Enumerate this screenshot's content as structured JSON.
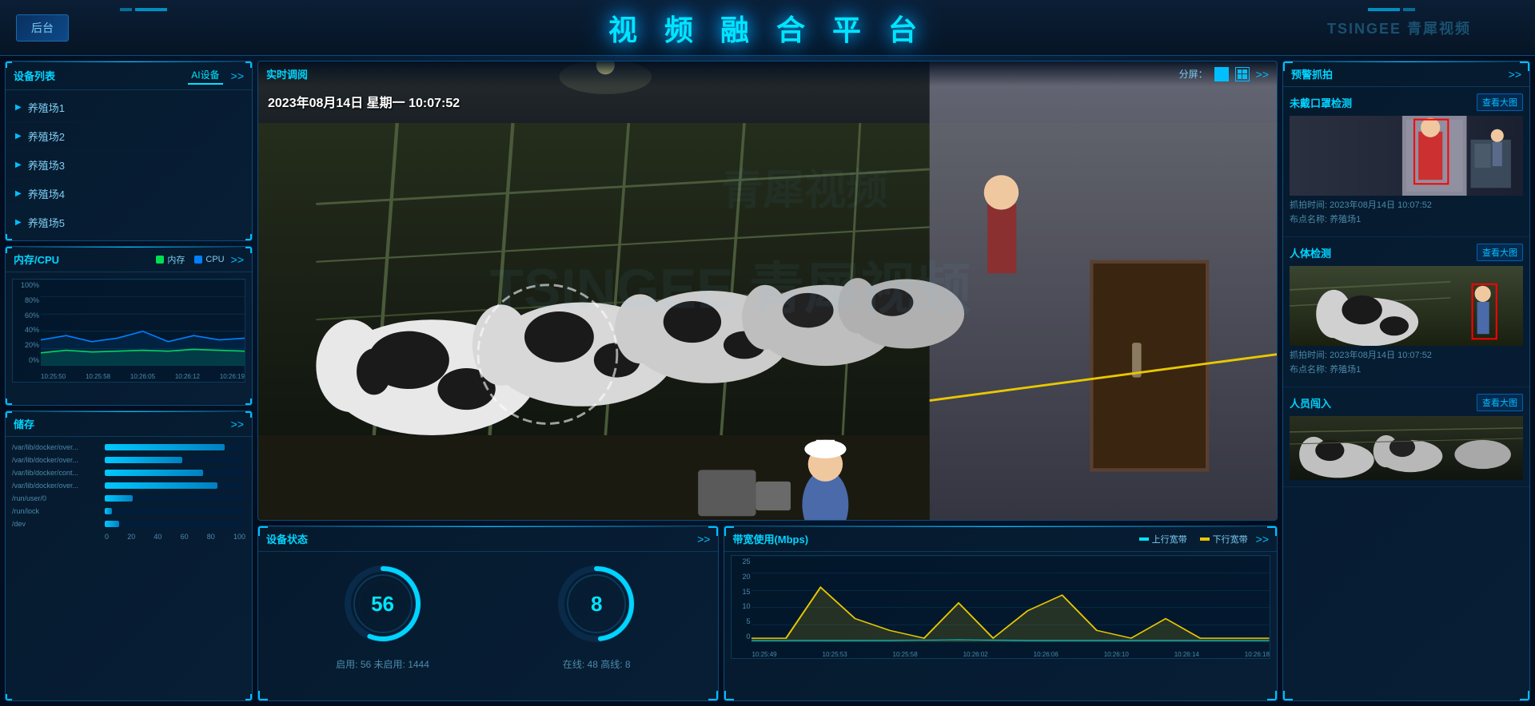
{
  "header": {
    "title": "视 频 融 合 平 台",
    "back_label": "后台",
    "logo": "TSINGEE 青犀视频"
  },
  "left": {
    "device_list": {
      "title": "设备列表",
      "tab": "AI设备",
      "more": ">>",
      "items": [
        {
          "label": "养殖场1"
        },
        {
          "label": "养殖场2"
        },
        {
          "label": "养殖场3"
        },
        {
          "label": "养殖场4"
        },
        {
          "label": "养殖场5"
        }
      ]
    },
    "cpu_memory": {
      "title": "内存/CPU",
      "more": ">>",
      "legend_memory": "内存",
      "legend_cpu": "CPU",
      "y_labels": [
        "100%",
        "80%",
        "60%",
        "40%",
        "20%",
        "0%"
      ],
      "x_labels": [
        "10:25:50",
        "10:25:58",
        "10:26:05",
        "10:26:12",
        "10:26:19"
      ]
    },
    "storage": {
      "title": "储存",
      "more": ">>",
      "items": [
        {
          "label": "/var/lib/docker/over...",
          "pct": 85
        },
        {
          "label": "/var/lib/docker/over...",
          "pct": 55
        },
        {
          "label": "/var/lib/docker/cont...",
          "pct": 70
        },
        {
          "label": "/var/lib/docker/over...",
          "pct": 80
        },
        {
          "label": "/run/user/0",
          "pct": 20
        },
        {
          "label": "/run/lock",
          "pct": 5
        },
        {
          "label": "/dev",
          "pct": 10
        }
      ],
      "x_axis": [
        "0",
        "20",
        "40",
        "60",
        "80",
        "100"
      ]
    }
  },
  "center": {
    "video": {
      "title": "实时调阅",
      "split_label": "分屏：",
      "more": ">>",
      "timestamp": "2023年08月14日  星期一  10:07:52"
    },
    "device_status": {
      "title": "设备状态",
      "more": ">>",
      "online_count": "56",
      "offline_count": "1444",
      "total_count": "8",
      "gauge1_value": 56,
      "gauge1_max": 100,
      "gauge2_value": 48,
      "gauge2_max": 100,
      "gauge1_label": "启用: 56 未启用: 1444",
      "gauge2_label": "在线: 48 高线: 8"
    },
    "bandwidth": {
      "title": "带宽使用(Mbps)",
      "more": ">>",
      "legend_up": "上行宽带",
      "legend_down": "下行宽带",
      "y_labels": [
        "25",
        "20",
        "15",
        "10",
        "5",
        "0"
      ],
      "x_labels": [
        "10:25:49",
        "10:25:53",
        "10:25:58",
        "10:26:02",
        "10:26:06",
        "10:26:10",
        "10:26:14",
        "10:26:18"
      ]
    }
  },
  "right": {
    "title": "预警抓拍",
    "more": ">>",
    "alerts": [
      {
        "id": "alert-mask",
        "title": "未戴口罩检测",
        "view_label": "查看大图",
        "capture_time": "抓拍时间: 2023年08月14日 10:07:52",
        "location": "布点名称: 养殖场1"
      },
      {
        "id": "alert-person",
        "title": "人体检测",
        "view_label": "查看大图",
        "capture_time": "抓拍时间: 2023年08月14日 10:07:52",
        "location": "布点名称: 养殖场1"
      },
      {
        "id": "alert-intrude",
        "title": "人员闯入",
        "view_label": "查看大图",
        "capture_time": "",
        "location": ""
      }
    ]
  }
}
